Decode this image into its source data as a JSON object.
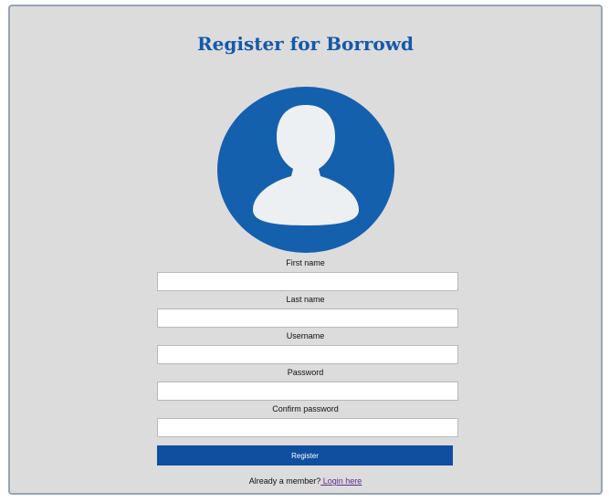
{
  "form": {
    "title": "Register for Borrowd",
    "avatar_icon": "user-avatar-icon",
    "fields": [
      {
        "label": "First name",
        "value": "",
        "placeholder": ""
      },
      {
        "label": "Last name",
        "value": "",
        "placeholder": ""
      },
      {
        "label": "Username",
        "value": "",
        "placeholder": ""
      },
      {
        "label": "Password",
        "value": "",
        "placeholder": ""
      },
      {
        "label": "Confirm password",
        "value": "",
        "placeholder": ""
      }
    ],
    "register_label": "Register",
    "footer_text": "Already a member?",
    "login_link": " Login here"
  },
  "colors": {
    "panel_bg": "#dcdcdc",
    "title": "#1559a8",
    "avatar_bg": "#1560ad",
    "avatar_figure": "#edf0f2",
    "button_bg": "#0f4fa0",
    "link": "#5a2d91"
  }
}
